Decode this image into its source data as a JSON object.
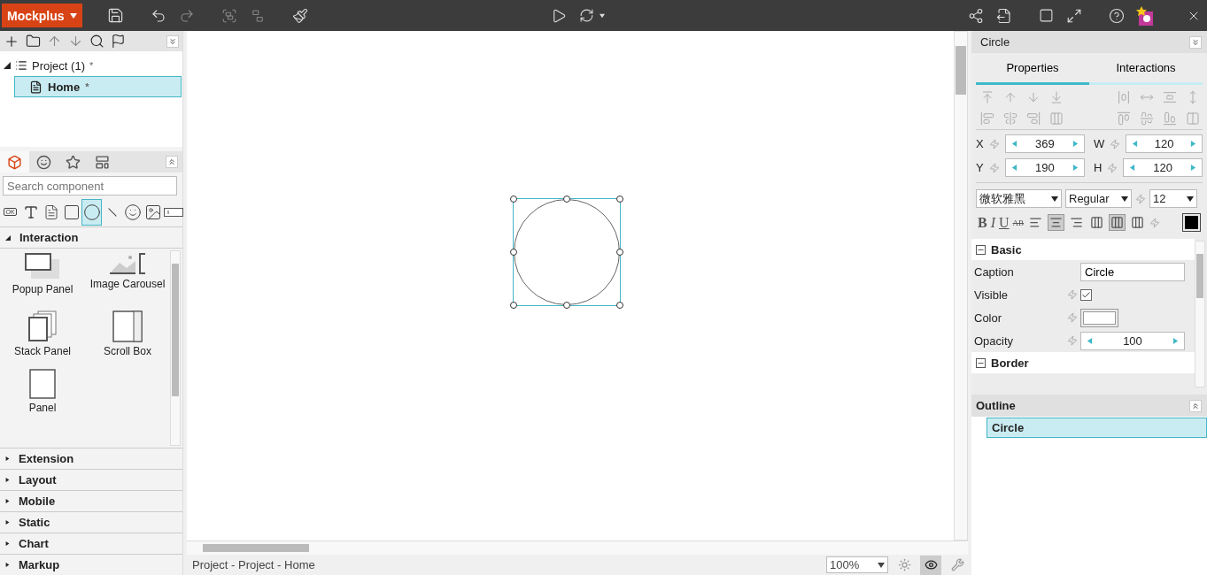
{
  "app_menu": {
    "label": "Mockplus"
  },
  "project_tree": [
    {
      "label": "Project (1)",
      "mark": "*",
      "expanded": true,
      "selected": false,
      "children": [
        {
          "label": "Home",
          "mark": "*",
          "selected": true
        }
      ]
    }
  ],
  "component_tabs": [
    {
      "kind": "box",
      "selected": true
    },
    {
      "kind": "emoji",
      "selected": false
    },
    {
      "kind": "star",
      "selected": false
    },
    {
      "kind": "layout",
      "selected": false
    }
  ],
  "search": {
    "placeholder": "Search component"
  },
  "quick_components": [
    {
      "kind": "button",
      "label": "OK",
      "selected": false
    },
    {
      "kind": "text",
      "selected": false
    },
    {
      "kind": "paragraph",
      "selected": false
    },
    {
      "kind": "rectangle",
      "selected": false
    },
    {
      "kind": "circle",
      "selected": true
    },
    {
      "kind": "line",
      "selected": false
    },
    {
      "kind": "emoji",
      "selected": false
    },
    {
      "kind": "image",
      "selected": false
    },
    {
      "kind": "input",
      "selected": false
    }
  ],
  "categories": [
    {
      "label": "Interaction",
      "expanded": true,
      "items": [
        {
          "label": "Popup Panel",
          "kind": "popup"
        },
        {
          "label": "Image Carousel",
          "kind": "carousel"
        },
        {
          "label": "Stack Panel",
          "kind": "stack"
        },
        {
          "label": "Scroll Box",
          "kind": "scroll"
        },
        {
          "label": "Panel",
          "kind": "panel"
        }
      ]
    },
    {
      "label": "Extension",
      "expanded": false
    },
    {
      "label": "Layout",
      "expanded": false
    },
    {
      "label": "Mobile",
      "expanded": false
    },
    {
      "label": "Static",
      "expanded": false
    },
    {
      "label": "Chart",
      "expanded": false
    },
    {
      "label": "Markup",
      "expanded": false
    }
  ],
  "canvas": {
    "shape": {
      "kind": "circle",
      "selected": true
    }
  },
  "status_bar": {
    "breadcrumb": "Project - Project - Home",
    "zoom": "100%",
    "toggles": [
      {
        "kind": "sun",
        "selected": false
      },
      {
        "kind": "eye",
        "selected": true
      },
      {
        "kind": "wrench",
        "selected": false
      }
    ]
  },
  "inspector": {
    "title": "Circle",
    "tabs": [
      {
        "label": "Properties",
        "selected": true
      },
      {
        "label": "Interactions",
        "selected": false
      }
    ],
    "geometry": [
      {
        "label": "X",
        "value": "369"
      },
      {
        "label": "W",
        "value": "120"
      },
      {
        "label": "Y",
        "value": "190"
      },
      {
        "label": "H",
        "value": "120"
      }
    ],
    "font": {
      "family": "微软雅黑",
      "style": "Regular",
      "size": "12"
    },
    "format_buttons": [
      {
        "kind": "bold",
        "label": "B"
      },
      {
        "kind": "italic",
        "label": "I"
      },
      {
        "kind": "underline",
        "label": "U"
      },
      {
        "kind": "strike",
        "label": "AB"
      }
    ],
    "text_align": [
      {
        "selected": false
      },
      {
        "selected": true
      },
      {
        "selected": false
      }
    ],
    "vertical_align": [
      {
        "selected": false
      },
      {
        "selected": true
      },
      {
        "selected": false
      }
    ],
    "sections": [
      {
        "title": "Basic",
        "expanded": true,
        "rows": [
          {
            "kind": "text",
            "label": "Caption",
            "value": "Circle"
          },
          {
            "kind": "checkbox",
            "label": "Visible",
            "checked": true
          },
          {
            "kind": "color",
            "label": "Color",
            "color": "#ffffff"
          },
          {
            "kind": "stepper",
            "label": "Opacity",
            "value": "100"
          }
        ]
      },
      {
        "title": "Border",
        "expanded": true
      }
    ]
  },
  "outline": {
    "title": "Outline",
    "items": [
      {
        "label": "Circle",
        "selected": true
      }
    ]
  }
}
